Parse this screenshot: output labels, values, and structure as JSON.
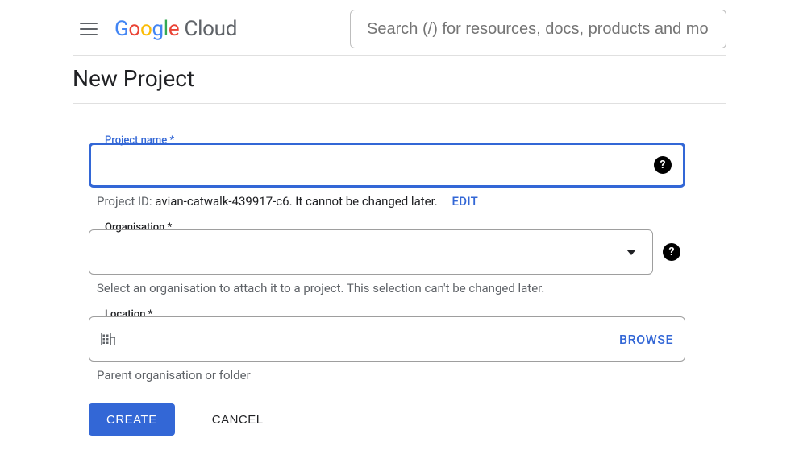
{
  "header": {
    "logo_google": "Google",
    "logo_cloud": "Cloud",
    "search_placeholder": "Search (/) for resources, docs, products and more"
  },
  "page": {
    "title": "New Project"
  },
  "project_name": {
    "label": "Project name *",
    "value": "",
    "id_prefix": "Project ID: ",
    "id_value": "avian-catwalk-439917-c6",
    "id_note": ". It cannot be changed later.",
    "edit": "EDIT"
  },
  "organisation": {
    "label": "Organisation *",
    "value": "",
    "hint": "Select an organisation to attach it to a project. This selection can't be changed later."
  },
  "location": {
    "label": "Location *",
    "value": "",
    "browse": "BROWSE",
    "hint": "Parent organisation or folder"
  },
  "actions": {
    "create": "CREATE",
    "cancel": "CANCEL"
  }
}
